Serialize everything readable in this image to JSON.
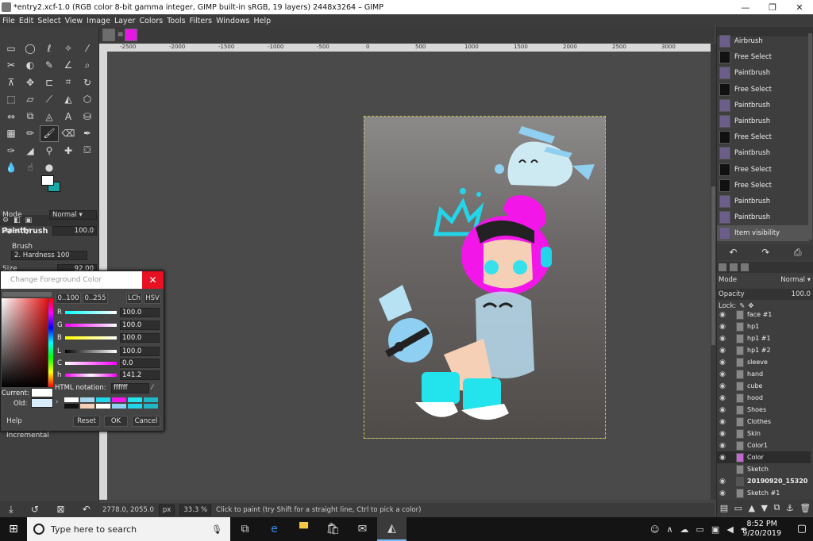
{
  "window": {
    "title": "*entry2.xcf-1.0 (RGB color 8-bit gamma integer, GIMP built-in sRGB, 19 layers) 2448x3264 – GIMP",
    "minimize": "—",
    "maximize": "❐",
    "close": "✕"
  },
  "menu": [
    "File",
    "Edit",
    "Select",
    "View",
    "Image",
    "Layer",
    "Colors",
    "Tools",
    "Filters",
    "Windows",
    "Help"
  ],
  "ruler": {
    "ticks": [
      "-2500",
      "-2000",
      "-1500",
      "-1000",
      "-500",
      "0",
      "500",
      "1000",
      "1500",
      "2000",
      "2500",
      "3000"
    ]
  },
  "tool_options": {
    "title": "Paintbrush",
    "mode_label": "Mode",
    "mode_value": "Normal",
    "opacity_label": "Opacity",
    "opacity_value": "100.0",
    "brush_label": "Brush",
    "brush_value": "2. Hardness 100",
    "size_label": "Size",
    "size_value": "92.00",
    "incremental_label": "Incremental"
  },
  "dialog": {
    "title": "Change Foreground Color",
    "range_a": "0..100",
    "range_b": "0..255",
    "mode_lch": "LCh",
    "mode_hsv": "HSV",
    "sliders": [
      {
        "label": "R",
        "value": "100.0"
      },
      {
        "label": "G",
        "value": "100.0"
      },
      {
        "label": "B",
        "value": "100.0"
      },
      {
        "label": "L",
        "value": "100.0"
      },
      {
        "label": "C",
        "value": "0.0"
      },
      {
        "label": "h",
        "value": "141.2"
      }
    ],
    "html_label": "HTML notation:",
    "html_value": "ffffff",
    "current_label": "Current:",
    "old_label": "Old:",
    "help_button": "Help",
    "reset_button": "Reset",
    "ok_button": "OK",
    "cancel_button": "Cancel"
  },
  "history": {
    "items": [
      "Airbrush",
      "Free Select",
      "Paintbrush",
      "Free Select",
      "Paintbrush",
      "Paintbrush",
      "Free Select",
      "Paintbrush",
      "Free Select",
      "Free Select",
      "Paintbrush",
      "Paintbrush",
      "Item visibility"
    ]
  },
  "layers_panel": {
    "mode_label": "Mode",
    "mode_value": "Normal",
    "opacity_label": "Opacity",
    "opacity_value": "100.0",
    "lock_label": "Lock:",
    "layers": [
      "face #1",
      "hp1",
      "hp1 #1",
      "hp1 #2",
      "sleeve",
      "hand",
      "cube",
      "hood",
      "Shoes",
      "Clothes",
      "Skin",
      "Color1",
      "Color",
      "Sketch",
      "20190920_15320",
      "Sketch #1"
    ]
  },
  "status": {
    "coords": "2778.0, 2055.0",
    "unit": "px",
    "zoom": "33.3 %",
    "message": "Click to paint (try Shift for a straight line, Ctrl to pick a color)"
  },
  "taskbar": {
    "search_placeholder": "Type here to search",
    "time": "8:52 PM",
    "date": "9/20/2019"
  },
  "colors": {
    "foreground": "#ffffff",
    "background": "#19a6a6",
    "close_red": "#e81123"
  }
}
